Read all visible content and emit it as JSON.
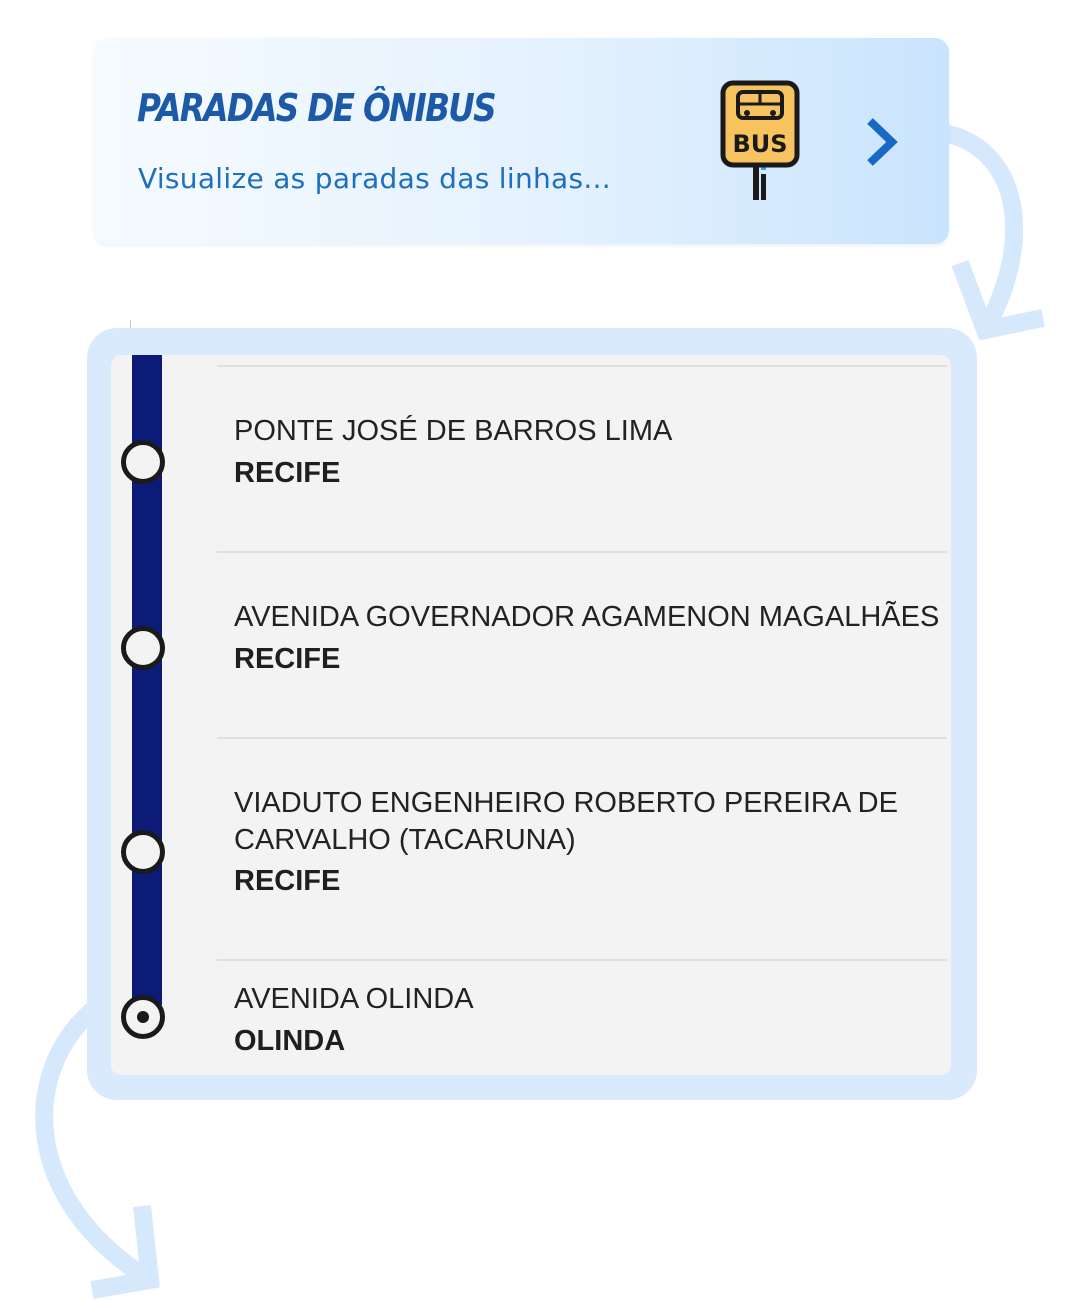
{
  "header": {
    "title": "PARADAS DE ÔNIBUS",
    "subtitle": "Visualize as paradas das linhas...",
    "icon": "bus-stop-icon",
    "icon_text": "BUS",
    "action_icon": "chevron-right-icon"
  },
  "stops": [
    {
      "name": "PONTE JOSÉ DE BARROS LIMA",
      "city": "RECIFE",
      "current": false
    },
    {
      "name": "AVENIDA GOVERNADOR AGAMENON MAGALHÃES",
      "city": "RECIFE",
      "current": false
    },
    {
      "name": "VIADUTO ENGENHEIRO ROBERTO PEREIRA DE CARVALHO (TACARUNA)",
      "city": "RECIFE",
      "current": false
    },
    {
      "name": "AVENIDA OLINDA",
      "city": "OLINDA",
      "current": true
    }
  ],
  "colors": {
    "title": "#1c5aa8",
    "subtitle": "#1d6fc2",
    "route_line": "#0c1b78",
    "frame": "#d8eafc",
    "decorative_arrow": "#d6e9fc",
    "bus_sign": "#f7c35f",
    "chevron": "#1769c4"
  }
}
